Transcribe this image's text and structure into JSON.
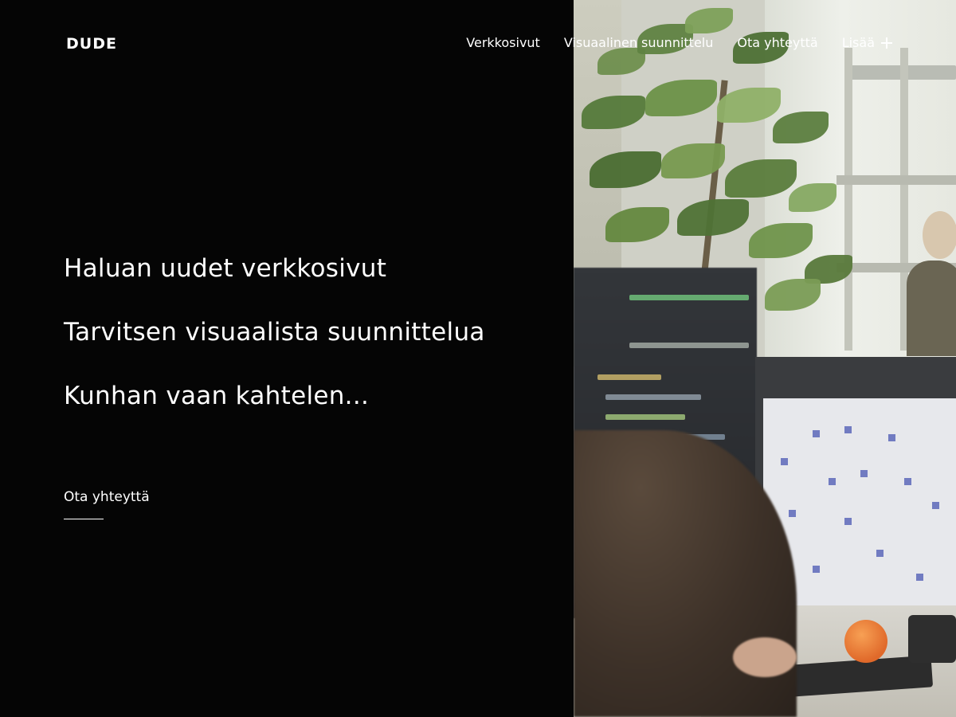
{
  "header": {
    "logo": "DUDE",
    "nav": [
      {
        "label": "Verkkosivut"
      },
      {
        "label": "Visuaalinen suunnittelu"
      },
      {
        "label": "Ota yhteyttä"
      },
      {
        "label": "Lisää",
        "icon": "plus-icon"
      }
    ]
  },
  "hero": {
    "options": [
      "Haluan uudet verkkosivut",
      "Tarvitsen visuaalista suunnittelua",
      "Kunhan vaan kahtelen..."
    ],
    "cta": "Ota yhteyttä"
  },
  "colors": {
    "background": "#050505",
    "text": "#ffffff"
  }
}
